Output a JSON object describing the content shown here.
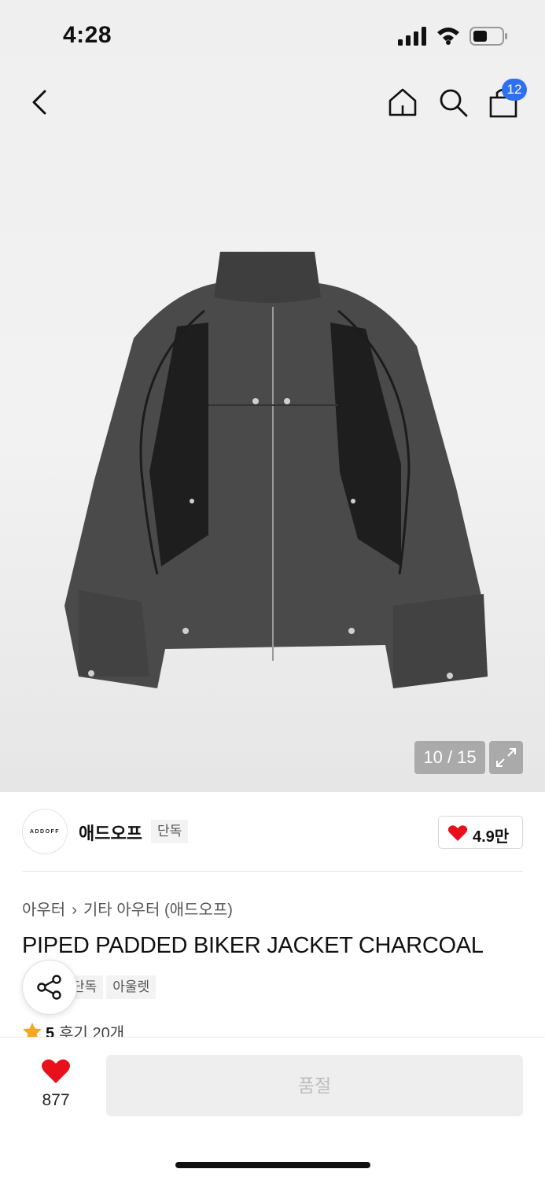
{
  "status_bar": {
    "time": "4:28"
  },
  "nav": {
    "cart_count": "12"
  },
  "gallery": {
    "counter": "10 / 15"
  },
  "brand": {
    "logo_text": "ADDOFF",
    "name": "애드오프",
    "tag": "단독",
    "likes": "4.9만"
  },
  "breadcrumb": {
    "level1": "아우터",
    "level2": "기타 아우터 (애드오프)"
  },
  "product": {
    "title": "PIPED PADDED BIKER JACKET CHARCOAL",
    "tags": [
      "단독",
      "아울렛"
    ],
    "rating": "5",
    "reviews": "후기 20개"
  },
  "bottom_bar": {
    "wish_count": "877",
    "soldout_label": "품절"
  },
  "colors": {
    "accent": "#2f6ff2",
    "heart": "#e8101a",
    "star": "#f5a623"
  },
  "icons": [
    "back-icon",
    "home-icon",
    "search-icon",
    "bag-icon",
    "expand-icon",
    "heart-icon",
    "share-icon",
    "star-icon"
  ]
}
